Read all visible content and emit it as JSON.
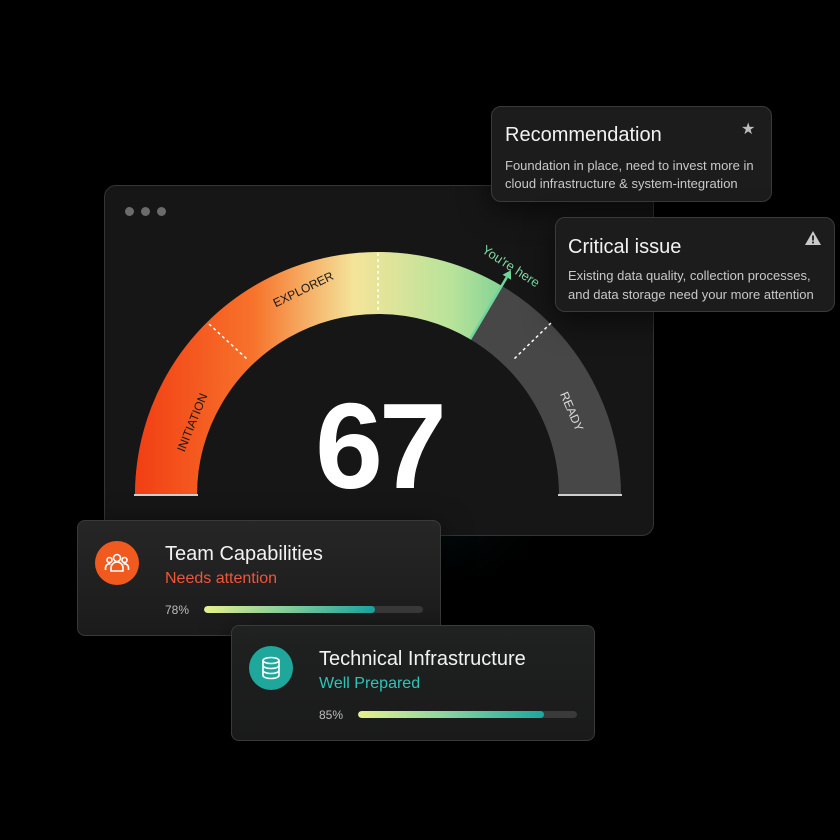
{
  "window": {
    "dots_count": 3
  },
  "gauge": {
    "score": "67",
    "score_value": 67,
    "segments": [
      "INITIATION",
      "EXPLORER",
      "READY"
    ],
    "marker_label": "You're here",
    "colors": {
      "orange": "#f0521f",
      "yellow": "#f5f19a",
      "green": "#5fc99a",
      "grey": "#474747"
    }
  },
  "recommendation": {
    "title": "Recommendation",
    "text_line1": "Foundation in place, need to invest more in",
    "text_line2": "cloud infrastructure & system-integration",
    "icon": "star-icon"
  },
  "critical": {
    "title": "Critical issue",
    "text_line1": "Existing data quality, collection processes,",
    "text_line2": "and data storage need your more attention",
    "icon": "warning-icon"
  },
  "metrics": [
    {
      "title": "Team Capabilities",
      "status": "Needs attention",
      "status_color": "#f1553b",
      "percent_label": "78%",
      "percent": 78,
      "icon": "team-icon",
      "icon_color": "#f05a1e"
    },
    {
      "title": "Technical Infrastructure",
      "status": "Well Prepared",
      "status_color": "#2ec4b6",
      "percent_label": "85%",
      "percent": 85,
      "icon": "database-icon",
      "icon_color": "#1fa79c"
    }
  ]
}
